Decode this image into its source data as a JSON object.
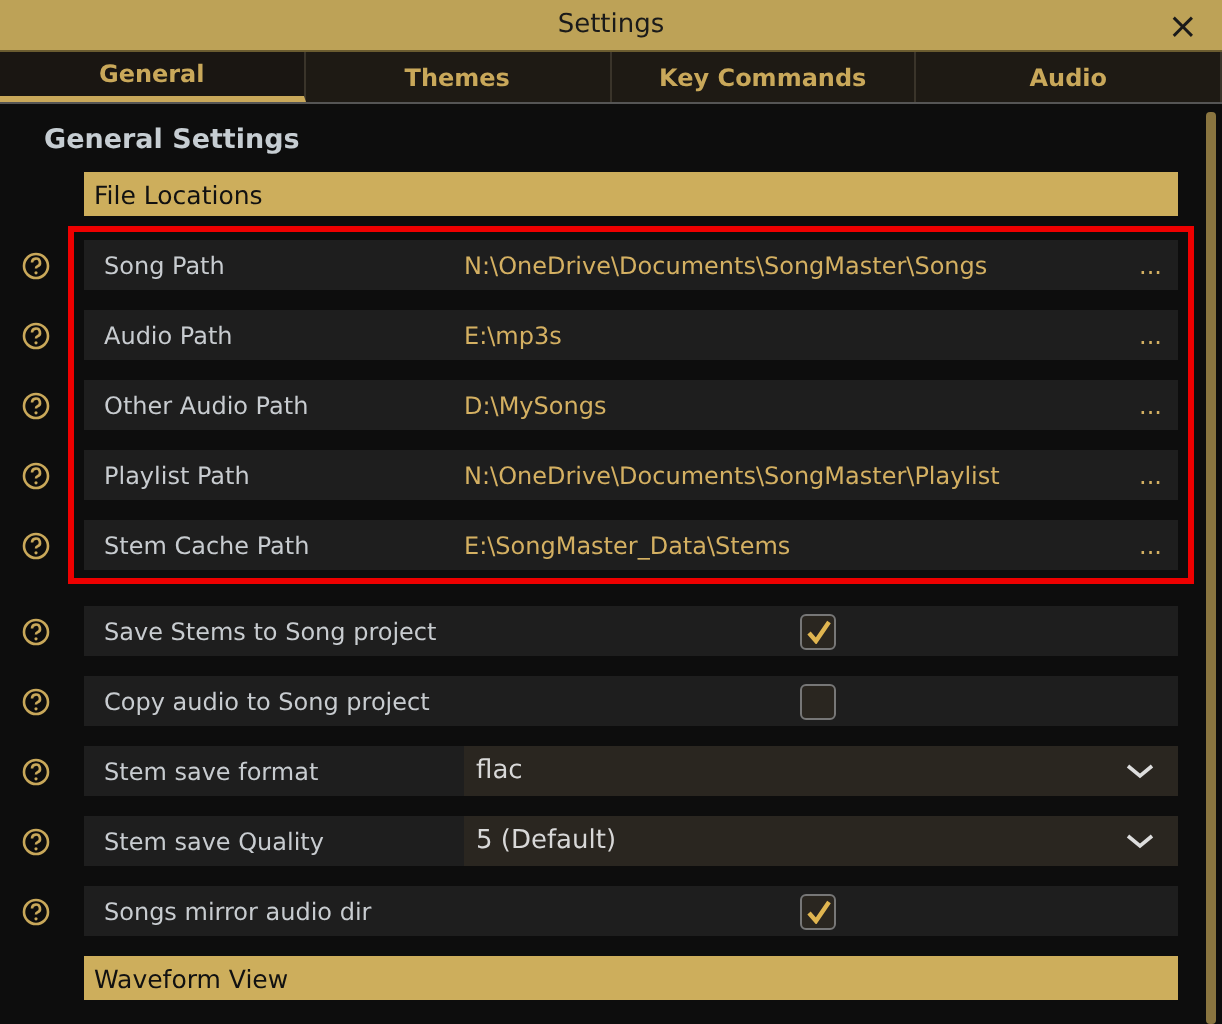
{
  "window": {
    "title": "Settings",
    "close": "×"
  },
  "tabs": [
    {
      "label": "General",
      "selected": true
    },
    {
      "label": "Themes",
      "selected": false
    },
    {
      "label": "Key Commands",
      "selected": false
    },
    {
      "label": "Audio",
      "selected": false
    }
  ],
  "heading": "General Settings",
  "sections": [
    {
      "title": "File Locations",
      "blocks": [
        {
          "highlighted": true,
          "rows": [
            {
              "kind": "path",
              "label": "Song Path",
              "value": "N:\\OneDrive\\Documents\\SongMaster\\Songs",
              "action": "..."
            },
            {
              "kind": "path",
              "label": "Audio Path",
              "value": "E:\\mp3s",
              "action": "..."
            },
            {
              "kind": "path",
              "label": "Other Audio Path",
              "value": "D:\\MySongs",
              "action": "..."
            },
            {
              "kind": "path",
              "label": "Playlist Path",
              "value": "N:\\OneDrive\\Documents\\SongMaster\\Playlist",
              "action": "..."
            },
            {
              "kind": "path",
              "label": "Stem Cache Path",
              "value": "E:\\SongMaster_Data\\Stems",
              "action": "..."
            }
          ]
        },
        {
          "highlighted": false,
          "rows": [
            {
              "kind": "checkbox",
              "label": "Save Stems to Song project",
              "checked": true
            },
            {
              "kind": "checkbox",
              "label": "Copy audio to Song project",
              "checked": false
            },
            {
              "kind": "dropdown",
              "label": "Stem save format",
              "value": "flac"
            },
            {
              "kind": "dropdown",
              "label": "Stem save Quality",
              "value": "5 (Default)"
            },
            {
              "kind": "checkbox",
              "label": "Songs mirror audio dir",
              "checked": true
            }
          ]
        }
      ]
    },
    {
      "title": "Waveform View"
    }
  ]
}
